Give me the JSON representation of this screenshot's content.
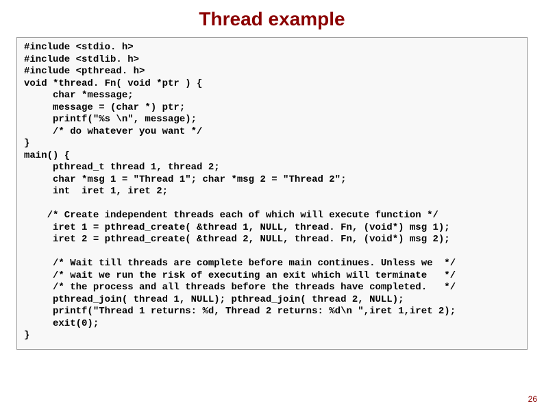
{
  "title": "Thread example",
  "pagenum": "26",
  "code": "#include <stdio. h>\n#include <stdlib. h>\n#include <pthread. h>\nvoid *thread. Fn( void *ptr ) {\n     char *message;\n     message = (char *) ptr;\n     printf(\"%s \\n\", message);\n     /* do whatever you want */\n}\nmain() {\n     pthread_t thread 1, thread 2;\n     char *msg 1 = \"Thread 1\"; char *msg 2 = \"Thread 2\";\n     int  iret 1, iret 2;\n\n    /* Create independent threads each of which will execute function */\n     iret 1 = pthread_create( &thread 1, NULL, thread. Fn, (void*) msg 1);\n     iret 2 = pthread_create( &thread 2, NULL, thread. Fn, (void*) msg 2);\n\n     /* Wait till threads are complete before main continues. Unless we  */\n     /* wait we run the risk of executing an exit which will terminate   */\n     /* the process and all threads before the threads have completed.   */\n     pthread_join( thread 1, NULL); pthread_join( thread 2, NULL);\n     printf(\"Thread 1 returns: %d, Thread 2 returns: %d\\n \",iret 1,iret 2);\n     exit(0);\n}"
}
